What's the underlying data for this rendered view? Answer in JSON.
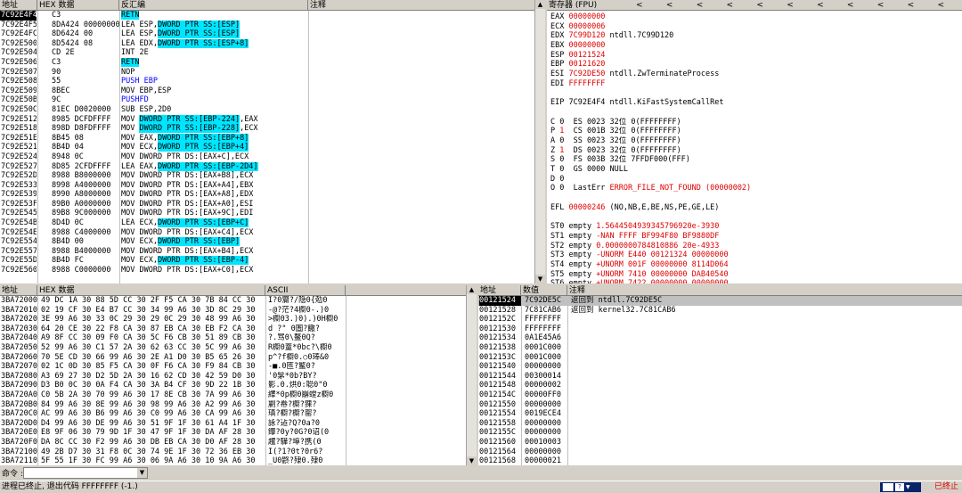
{
  "disasm": {
    "headers": [
      "地址",
      "HEX 数据",
      "反汇编",
      "注释"
    ],
    "rows": [
      [
        "7C92E4F4",
        "C3",
        "RETN",
        "",
        "sel",
        "retn"
      ],
      [
        "7C92E4F5",
        "8DA424 00000000",
        "LEA ESP,",
        "DWORD PTR SS:[ESP]",
        "",
        ""
      ],
      [
        "7C92E4FC",
        "8D6424 00",
        "LEA ESP,",
        "DWORD PTR SS:[ESP]",
        "",
        ""
      ],
      [
        "7C92E500",
        "8D5424 08",
        "LEA EDX,",
        "DWORD PTR SS:[ESP+8]",
        "",
        ""
      ],
      [
        "7C92E504",
        "CD 2E",
        "INT 2E",
        "",
        "",
        ""
      ],
      [
        "7C92E506",
        "C3",
        "RETN",
        "",
        "",
        "retn"
      ],
      [
        "7C92E507",
        "90",
        "NOP",
        "",
        "",
        ""
      ],
      [
        "7C92E508",
        "55",
        "PUSH EBP",
        "",
        "",
        "blue"
      ],
      [
        "7C92E509",
        "8BEC",
        "MOV EBP,ESP",
        "",
        "",
        ""
      ],
      [
        "7C92E50B",
        "9C",
        "PUSHFD",
        "",
        "",
        "blue"
      ],
      [
        "7C92E50C",
        "81EC D0020000",
        "SUB ESP,2D0",
        "",
        "",
        ""
      ],
      [
        "7C92E512",
        "8985 DCFDFFFF",
        "MOV ",
        "DWORD PTR SS:[EBP-224]",
        ",EAX",
        ""
      ],
      [
        "7C92E518",
        "898D D8FDFFFF",
        "MOV ",
        "DWORD PTR SS:[EBP-228]",
        ",ECX",
        ""
      ],
      [
        "7C92E51E",
        "8B45 08",
        "MOV EAX,",
        "DWORD PTR SS:[EBP+8]",
        "",
        ""
      ],
      [
        "7C92E521",
        "8B4D 04",
        "MOV ECX,",
        "DWORD PTR SS:[EBP+4]",
        "",
        ""
      ],
      [
        "7C92E524",
        "8948 0C",
        "MOV DWORD PTR DS:[EAX+C],ECX",
        "",
        "",
        ""
      ],
      [
        "7C92E527",
        "8D85 2CFDFFFF",
        "LEA EAX,",
        "DWORD PTR SS:[EBP-2D4]",
        "",
        ""
      ],
      [
        "7C92E52D",
        "8988 B8000000",
        "MOV DWORD PTR DS:[EAX+B8],ECX",
        "",
        "",
        ""
      ],
      [
        "7C92E533",
        "8998 A4000000",
        "MOV DWORD PTR DS:[EAX+A4],EBX",
        "",
        "",
        ""
      ],
      [
        "7C92E539",
        "8990 A8000000",
        "MOV DWORD PTR DS:[EAX+A8],EDX",
        "",
        "",
        ""
      ],
      [
        "7C92E53F",
        "89B0 A0000000",
        "MOV DWORD PTR DS:[EAX+A0],ESI",
        "",
        "",
        ""
      ],
      [
        "7C92E545",
        "89B8 9C000000",
        "MOV DWORD PTR DS:[EAX+9C],EDI",
        "",
        "",
        ""
      ],
      [
        "7C92E54B",
        "8D4D 0C",
        "LEA ECX,",
        "DWORD PTR SS:[EBP+C]",
        "",
        ""
      ],
      [
        "7C92E54E",
        "8988 C4000000",
        "MOV DWORD PTR DS:[EAX+C4],ECX",
        "",
        "",
        ""
      ],
      [
        "7C92E554",
        "8B4D 00",
        "MOV ECX,",
        "DWORD PTR SS:[EBP]",
        "",
        ""
      ],
      [
        "7C92E557",
        "8988 B4000000",
        "MOV DWORD PTR DS:[EAX+B4],ECX",
        "",
        "",
        ""
      ],
      [
        "7C92E55D",
        "8B4D FC",
        "MOV ECX,",
        "DWORD PTR SS:[EBP-4]",
        "",
        ""
      ],
      [
        "7C92E560",
        "8988 C0000000",
        "MOV DWORD PTR DS:[EAX+C0],ECX",
        "",
        "",
        ""
      ]
    ]
  },
  "registers": {
    "title": "寄存器 (FPU)",
    "arrows": [
      "<",
      "<",
      "<",
      "<",
      "<",
      "<",
      "<",
      "<",
      "<",
      "<",
      "<"
    ],
    "rows": [
      [
        "EAX ",
        "00000000",
        ""
      ],
      [
        "ECX ",
        "00000006",
        ""
      ],
      [
        "EDX ",
        "7C99D120",
        " ntdll.7C99D120"
      ],
      [
        "EBX ",
        "00000000",
        ""
      ],
      [
        "ESP ",
        "00121524",
        ""
      ],
      [
        "EBP ",
        "00121620",
        ""
      ],
      [
        "ESI ",
        "7C92DE50",
        " ntdll.ZwTerminateProcess"
      ],
      [
        "EDI ",
        "FFFFFFFF",
        ""
      ],
      [
        "",
        "",
        ""
      ],
      [
        "EIP ",
        "7C92E4F4 ntdll.KiFastSystemCallRet",
        ""
      ],
      [
        "",
        "",
        ""
      ],
      [
        "C 0  ES 0023 32位 0(FFFFFFFF)",
        "",
        ""
      ],
      [
        "P 1  CS 001B 32位 0(FFFFFFFF)",
        "",
        ""
      ],
      [
        "A 0  SS 0023 32位 0(FFFFFFFF)",
        "",
        ""
      ],
      [
        "Z 1  DS 0023 32位 0(FFFFFFFF)",
        "",
        ""
      ],
      [
        "S 0  FS 003B 32位 7FFDF000(FFF)",
        "",
        ""
      ],
      [
        "T 0  GS 0000 NULL",
        "",
        ""
      ],
      [
        "D 0",
        "",
        ""
      ],
      [
        "O 0  LastErr ",
        "ERROR_FILE_NOT_FOUND (00000002)",
        ""
      ],
      [
        "",
        "",
        ""
      ],
      [
        "EFL ",
        "00000246",
        " (NO,NB,E,BE,NS,PE,GE,LE)"
      ],
      [
        "",
        "",
        ""
      ],
      [
        "ST0 empty ",
        "1.5644504939345796920e-3930",
        ""
      ],
      [
        "ST1 empty ",
        "-NAN FFFF BF994F80 BF9880DF",
        ""
      ],
      [
        "ST2 empty ",
        "0.0000000784810886 20e-4933",
        ""
      ],
      [
        "ST3 empty ",
        "-UNORM E440 00121324 00000000",
        ""
      ],
      [
        "ST4 empty ",
        "+UNORM 001F 00000000 8114D064",
        ""
      ],
      [
        "ST5 empty ",
        "+UNORM 7410 00000000 DAB40540",
        ""
      ],
      [
        "ST6 empty ",
        "+UNORM 7422 00000000 00000000",
        ""
      ],
      [
        "ST7 empty ",
        "0.0",
        ""
      ]
    ]
  },
  "dump": {
    "headers": [
      "地址",
      "HEX 数据",
      "ASCII"
    ],
    "rows": [
      [
        "3BA72000",
        "49 DC 1A 30 88 5D CC 30 2F F5 CA 30 7B 84 CC 30",
        "I?0齎?/隐0{勊0"
      ],
      [
        "3BA72010",
        "02 19 CF 30 E4 B7 CC 30 34 99 A6 30 3D 8C 29 30",
        "-@?茫?4櫉0-.)0"
      ],
      [
        "3BA72020",
        "3E 99 A6 30 33 0C 29 30 29 0C 29 30 48 99 A6 30",
        ">櫉03.)0).)0H櫉0"
      ],
      [
        "3BA72030",
        "64 20 CE 30 22 F8 CA 30 87 EB CA 30 EB F2 CA 30",
        "d ?\" 0圄?饊?"
      ],
      [
        "3BA72040",
        "A9 8F CC 30 09 F0 CA 30 5C F6 CB 30 51 89 CB 30",
        "?.骂0\\鳌0Q?"
      ],
      [
        "3BA72050",
        "52 99 A6 30 C1 57 2A 30 62 63 CC 30 5C 99 A6 30",
        "R櫉0罿*0bc?\\櫉0"
      ],
      [
        "3BA72060",
        "70 5E CD 30 66 99 A6 30 2E A1 D0 30 B5 65 26 30",
        "p^?f櫉0.○0琫&0"
      ],
      [
        "3BA72070",
        "02 1C 0D 30 85 F5 CA 30 0F F6 CA 30 F9 84 CB 30",
        "-■.0匜?鳘0?"
      ],
      [
        "3BA72080",
        "A3 69 27 30 D2 5D 2A 30 16 62 CD 30 42 59 D0 30",
        "'0髳*0b?BY?"
      ],
      [
        "3BA72090",
        "D3 B0 0C 30 0A F4 CA 30 3A B4 CF 30 9D 22 1B 30",
        "影.0.烘0:聪0\"0"
      ],
      [
        "3BA720A0",
        "C0 5B 2A 30 70 99 A6 30 17 8E CB 30 7A 99 A6 30",
        "繹*0p櫉0巐螳z櫉0"
      ],
      [
        "3BA720B0",
        "84 99 A6 30 8E 99 A6 30 98 99 A6 30 A2 99 A6 30",
        "剻?帣?櫉?猓?"
      ],
      [
        "3BA720C0",
        "AC 99 A6 30 B6 99 A6 30 C0 99 A6 30 CA 99 A6 30",
        "瑱?櫉?櫉?罂?"
      ],
      [
        "3BA720D0",
        "D4 99 A6 30 DE 99 A6 30 51 9F 1F 30 61 A4 1F 30",
        "詠?迠?Q?0a?0"
      ],
      [
        "3BA720E0",
        "E8 9F 06 30 79 9D 1F 30 47 9F 1F 30 DA AF 28 30",
        "鑻?0y?0G?0诏(0"
      ],
      [
        "3BA720F0",
        "DA 8C CC 30 F2 99 A6 30 DB EB CA 30 D0 AF 28 30",
        "趯?驊?埠?携(0"
      ],
      [
        "3BA72100",
        "49 2B D7 30 31 F8 0C 30 74 9E 1F 30 72 36 EB 30",
        "I(?1?0t?0r6?"
      ],
      [
        "3BA72110",
        "5F 55 1F 30 FC 99 A6 30 06 9A A6 30 10 9A A6 30",
        "_U0鼨?殔0.殔0"
      ]
    ]
  },
  "stack": {
    "headers": [
      "地址",
      "数值",
      "注释"
    ],
    "rows": [
      [
        "00121524",
        "7C92DE5C",
        "返回到 ntdll.7C92DE5C",
        "sel"
      ],
      [
        "00121528",
        "7C81CAB6",
        "返回到 kernel32.7C81CAB6",
        ""
      ],
      [
        "0012152C",
        "FFFFFFFF",
        "",
        ""
      ],
      [
        "00121530",
        "FFFFFFFF",
        "",
        ""
      ],
      [
        "00121534",
        "0A1E45A6",
        "",
        ""
      ],
      [
        "00121538",
        "0001C000",
        "",
        ""
      ],
      [
        "0012153C",
        "0001C000",
        "",
        ""
      ],
      [
        "00121540",
        "00000000",
        "",
        ""
      ],
      [
        "00121544",
        "00300014",
        "",
        ""
      ],
      [
        "00121548",
        "00000002",
        "",
        ""
      ],
      [
        "0012154C",
        "00000FF0",
        "",
        ""
      ],
      [
        "00121550",
        "00000000",
        "",
        ""
      ],
      [
        "00121554",
        "0019ECE4",
        "",
        ""
      ],
      [
        "00121558",
        "00000000",
        "",
        ""
      ],
      [
        "0012155C",
        "00000000",
        "",
        ""
      ],
      [
        "00121560",
        "00010003",
        "",
        ""
      ],
      [
        "00121564",
        "00000000",
        "",
        ""
      ],
      [
        "00121568",
        "00000021",
        "",
        ""
      ]
    ]
  },
  "command": {
    "label": "命令 :",
    "value": ""
  },
  "status": {
    "text": "进程已终止, 退出代码 FFFFFFFF (-1.)",
    "state": "已终止"
  }
}
